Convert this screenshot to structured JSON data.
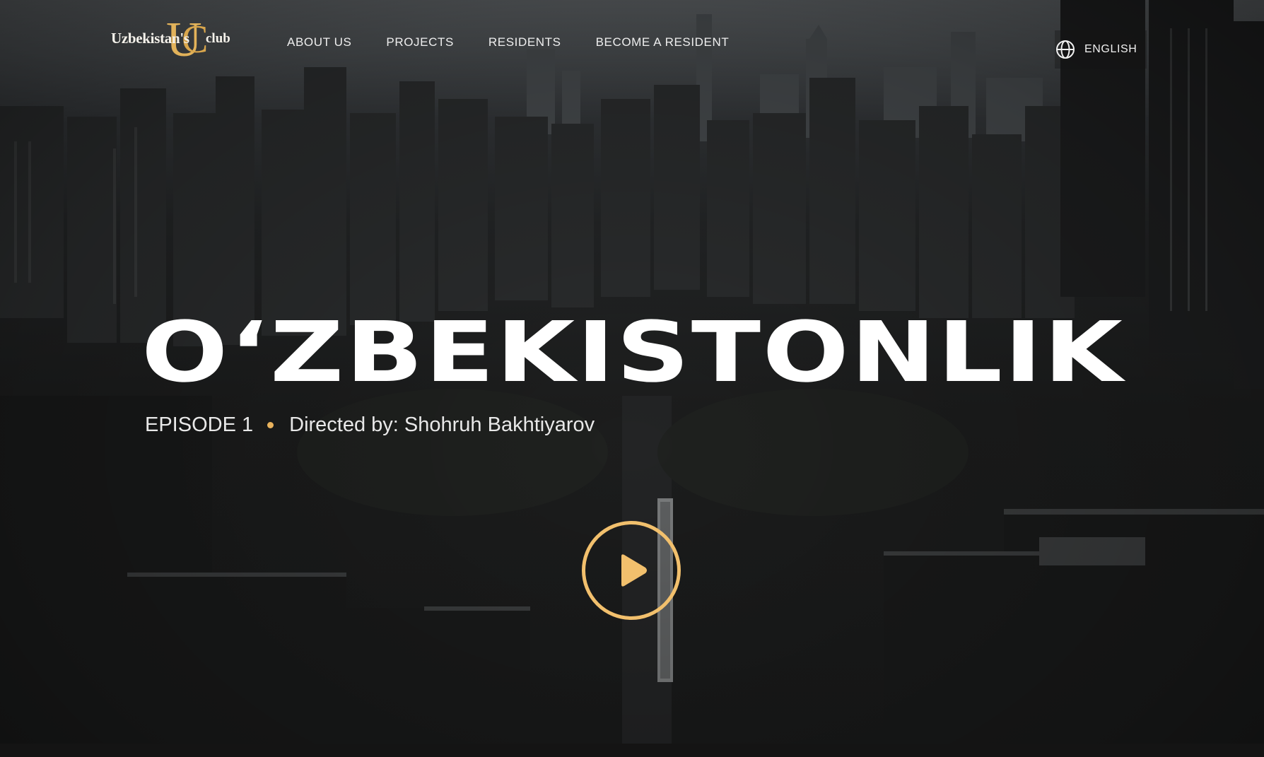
{
  "logo": {
    "text": "Uzbekistan's",
    "monogram_1": "U",
    "monogram_2": "C",
    "suffix": "club",
    "accent_color": "#e2b25a"
  },
  "nav": {
    "items": [
      {
        "label": "ABOUT US"
      },
      {
        "label": "PROJECTS"
      },
      {
        "label": "RESIDENTS"
      },
      {
        "label": "BECOME A RESIDENT"
      }
    ]
  },
  "language": {
    "icon": "globe-icon",
    "label": "ENGLISH"
  },
  "hero": {
    "title": "O‘ZBEKISTONLIK",
    "episode": "EPISODE 1",
    "director": "Directed by: Shohruh Bakhtiyarov",
    "play_icon": "play-icon",
    "accent_color": "#f2c06d"
  }
}
